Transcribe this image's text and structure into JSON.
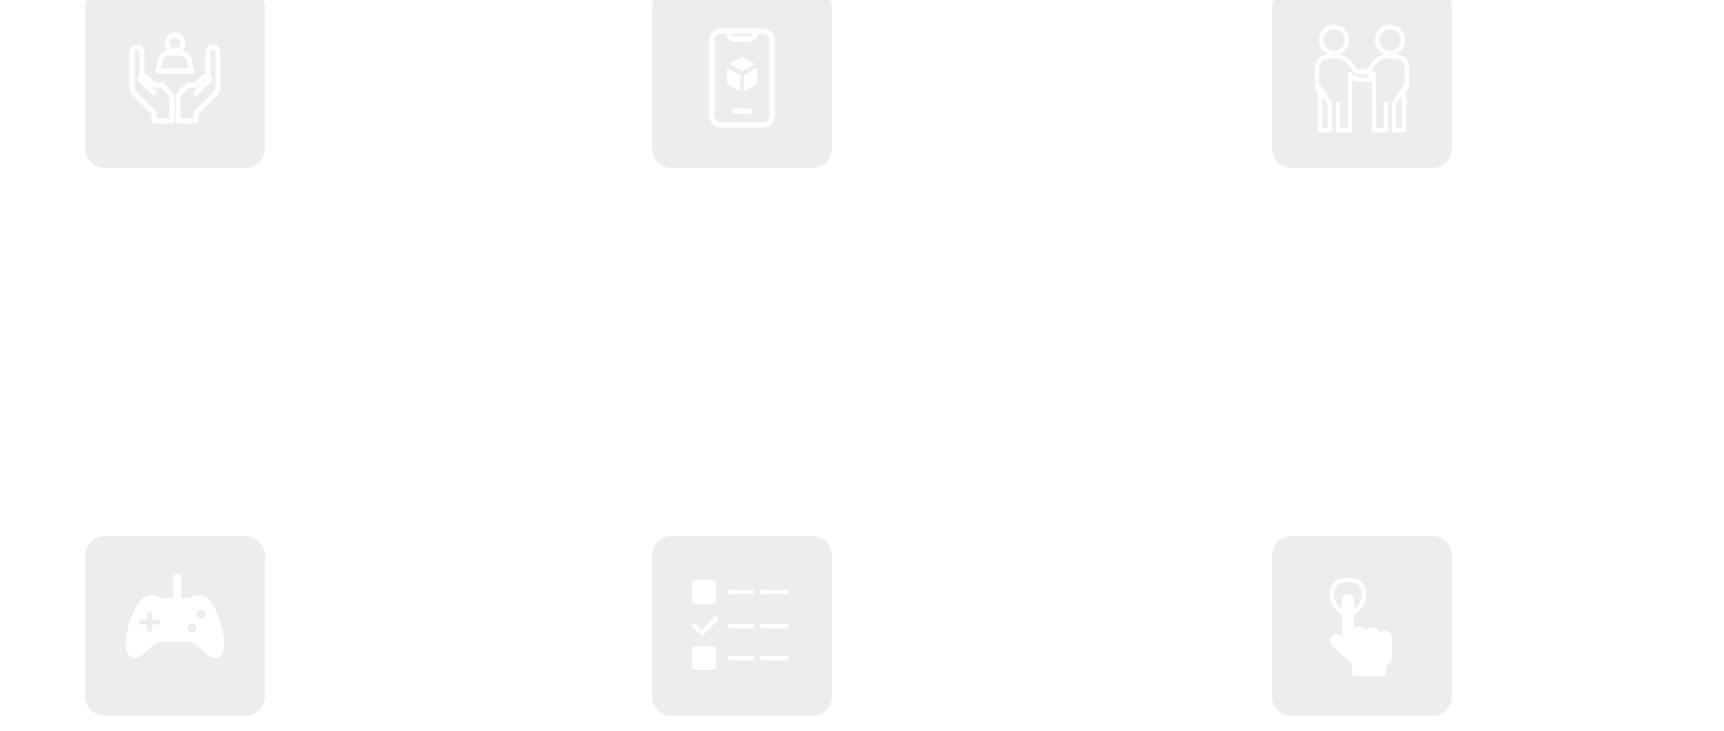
{
  "theme": {
    "tile_background": "#ededed",
    "icon_color": "#ffffff",
    "page_background": "#ffffff"
  },
  "tiles": [
    {
      "icon": "hands-holding-person-icon"
    },
    {
      "icon": "mobile-phone-package-icon"
    },
    {
      "icon": "two-people-icon"
    },
    {
      "icon": "game-controller-icon"
    },
    {
      "icon": "checklist-icon"
    },
    {
      "icon": "tap-gesture-icon"
    }
  ]
}
